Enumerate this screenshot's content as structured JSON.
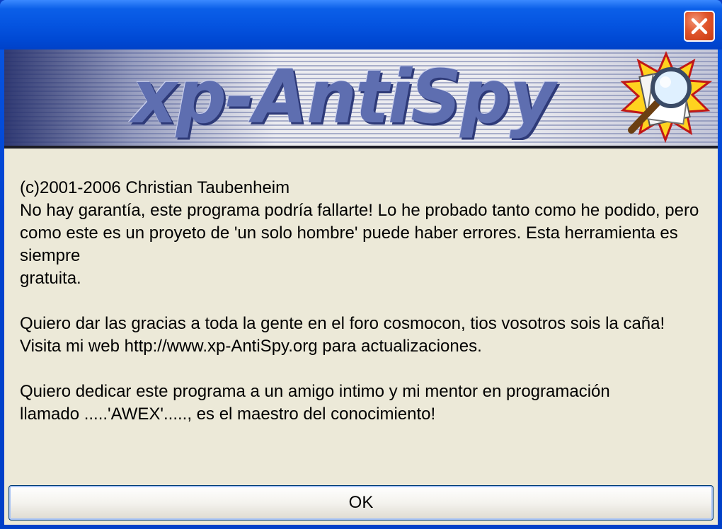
{
  "window": {
    "title": "",
    "close_label": "Close"
  },
  "banner": {
    "title": "xp-AntiSpy"
  },
  "message": {
    "lines": [
      "(c)2001-2006 Christian Taubenheim",
      "No hay garantía, este programa podría fallarte! Lo he probado tanto como he podido, pero",
      "como este es un proyeto de 'un solo hombre' puede haber errores. Esta herramienta es siempre",
      "gratuita.",
      "",
      "Quiero dar las gracias a toda la gente en el foro cosmocon, tios vosotros sois la caña!",
      "Visita mi web http://www.xp-AntiSpy.org para actualizaciones.",
      "",
      "Quiero dedicar este programa a un amigo intimo y mi mentor en programación",
      "llamado .....'AWEX'....., es el maestro del conocimiento!"
    ]
  },
  "buttons": {
    "ok_label": "OK"
  },
  "colors": {
    "titlebar": "#0554e0",
    "client_bg": "#ece9d8",
    "close_red": "#e0552c",
    "banner_text": "#5e6eb0"
  },
  "icons": {
    "close": "close-icon",
    "logo": "magnifier-logo-icon"
  }
}
